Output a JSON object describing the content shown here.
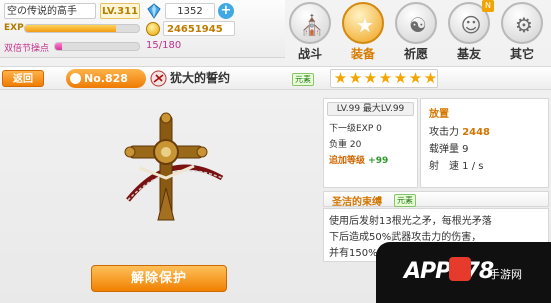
{
  "player": {
    "name": "空の传说的高手",
    "level": "LV.311",
    "gems": "1352",
    "plus": "+",
    "exp_label": "EXP",
    "exp_fraction": 0.8,
    "coins": "24651945",
    "double_label": "双倍节操点",
    "double_count": "15/180",
    "double_fraction": 0.08
  },
  "nav": [
    {
      "label": "战斗",
      "icon": "building-icon",
      "glyph": "⛪",
      "active": false
    },
    {
      "label": "装备",
      "icon": "star-shield-icon",
      "glyph": "★",
      "active": true
    },
    {
      "label": "祈愿",
      "icon": "wish-icon",
      "glyph": "☯",
      "active": false
    },
    {
      "label": "基友",
      "icon": "friend-icon",
      "glyph": "☺",
      "active": false,
      "badge": "N"
    },
    {
      "label": "其它",
      "icon": "other-icon",
      "glyph": "⚙",
      "active": false
    }
  ],
  "header": {
    "back": "返回",
    "number": "No.828",
    "weapon_name": "犹大的誓约",
    "element": "元素",
    "stars": 7
  },
  "stats": {
    "level_line": "LV.99  最大LV.99",
    "next_exp": "下一级EXP 0",
    "load": "负重 20",
    "bonus_label": "追加等级",
    "bonus_value": "+99",
    "section": "放置",
    "attack_label": "攻击力",
    "attack_value": "2448",
    "ammo": "载弹量 9",
    "rate": "射　速 1 / s"
  },
  "skill": {
    "name": "圣洁的束缚",
    "element": "元素",
    "line1": "使用后发射13根光之矛，每根光矛落",
    "line2": "下后造成50%武器攻击力的伤害，",
    "line3": "并有150%几率禁锢3秒"
  },
  "release_label": "解除保护",
  "watermark": {
    "text": "APP178",
    "sub": "手游网"
  },
  "colors": {
    "accent": "#f08000",
    "gold": "#d37600",
    "pink": "#c2318a"
  }
}
